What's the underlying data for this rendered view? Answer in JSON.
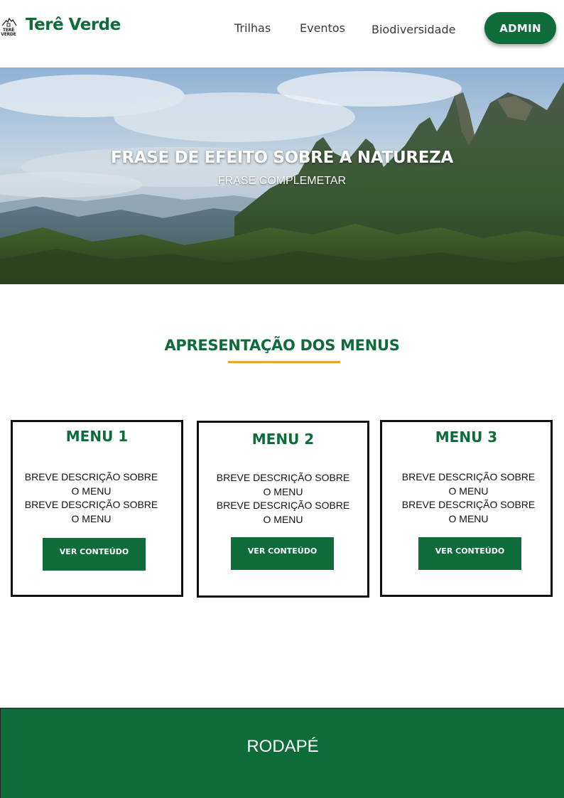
{
  "header": {
    "logo_mini": "TERÊ VERDE",
    "logo_text": "Terê Verde",
    "nav": [
      "Trilhas",
      "Eventos",
      "Biodiversidade"
    ],
    "admin_label": "ADMIN"
  },
  "hero": {
    "title": "FRASE DE EFEITO SOBRE A NATUREZA",
    "subtitle": "FRASE COMPLEMETAR"
  },
  "section": {
    "title": "APRESENTAÇÃO DOS MENUS"
  },
  "cards": [
    {
      "title": "MENU 1",
      "desc": [
        "BREVE DESCRIÇÃO SOBRE",
        "O MENU",
        "BREVE DESCRIÇÃO SOBRE",
        "O MENU"
      ],
      "button": "VER CONTEÚDO"
    },
    {
      "title": "MENU 2",
      "desc": [
        "BREVE DESCRIÇÃO SOBRE",
        "O MENU",
        "BREVE DESCRIÇÃO SOBRE",
        "O MENU"
      ],
      "button": "VER CONTEÚDO"
    },
    {
      "title": "MENU 3",
      "desc": [
        "BREVE DESCRIÇÃO SOBRE",
        "O MENU",
        "BREVE DESCRIÇÃO SOBRE",
        "O MENU"
      ],
      "button": "VER CONTEÚDO"
    }
  ],
  "footer": {
    "text": "RODAPÉ"
  },
  "colors": {
    "brand_green": "#0e6b3a",
    "accent_orange": "#f0a52a"
  }
}
